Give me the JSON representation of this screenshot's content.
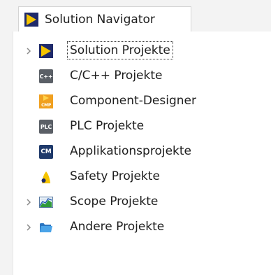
{
  "tab": {
    "title": "Solution Navigator",
    "icon": "solution-navigator-icon"
  },
  "tree": {
    "items": [
      {
        "label": "Solution Projekte",
        "icon": "solution-projects-icon",
        "expandable": true,
        "focused": true
      },
      {
        "label": "C/C++ Projekte",
        "icon": "cpp-projects-icon",
        "badge": "C++",
        "expandable": false
      },
      {
        "label": "Component-Designer",
        "icon": "component-designer-icon",
        "badge": "CMP",
        "expandable": false
      },
      {
        "label": "PLC Projekte",
        "icon": "plc-projects-icon",
        "badge": "PLC",
        "expandable": false
      },
      {
        "label": "Applikationsprojekte",
        "icon": "application-projects-icon",
        "badge": "CM",
        "expandable": false
      },
      {
        "label": "Safety Projekte",
        "icon": "safety-projects-icon",
        "expandable": false
      },
      {
        "label": "Scope Projekte",
        "icon": "scope-projects-icon",
        "expandable": true
      },
      {
        "label": "Andere Projekte",
        "icon": "other-projects-icon",
        "expandable": true
      }
    ]
  },
  "colors": {
    "brand_yellow": "#f5c400",
    "brand_navy": "#1f2a6b",
    "cpp_gray": "#5a5f66",
    "plc_gray": "#5a5f66",
    "cm_navy": "#1f3a6b",
    "cmp_orange": "#f0a020",
    "folder_blue": "#3a8fd8"
  }
}
